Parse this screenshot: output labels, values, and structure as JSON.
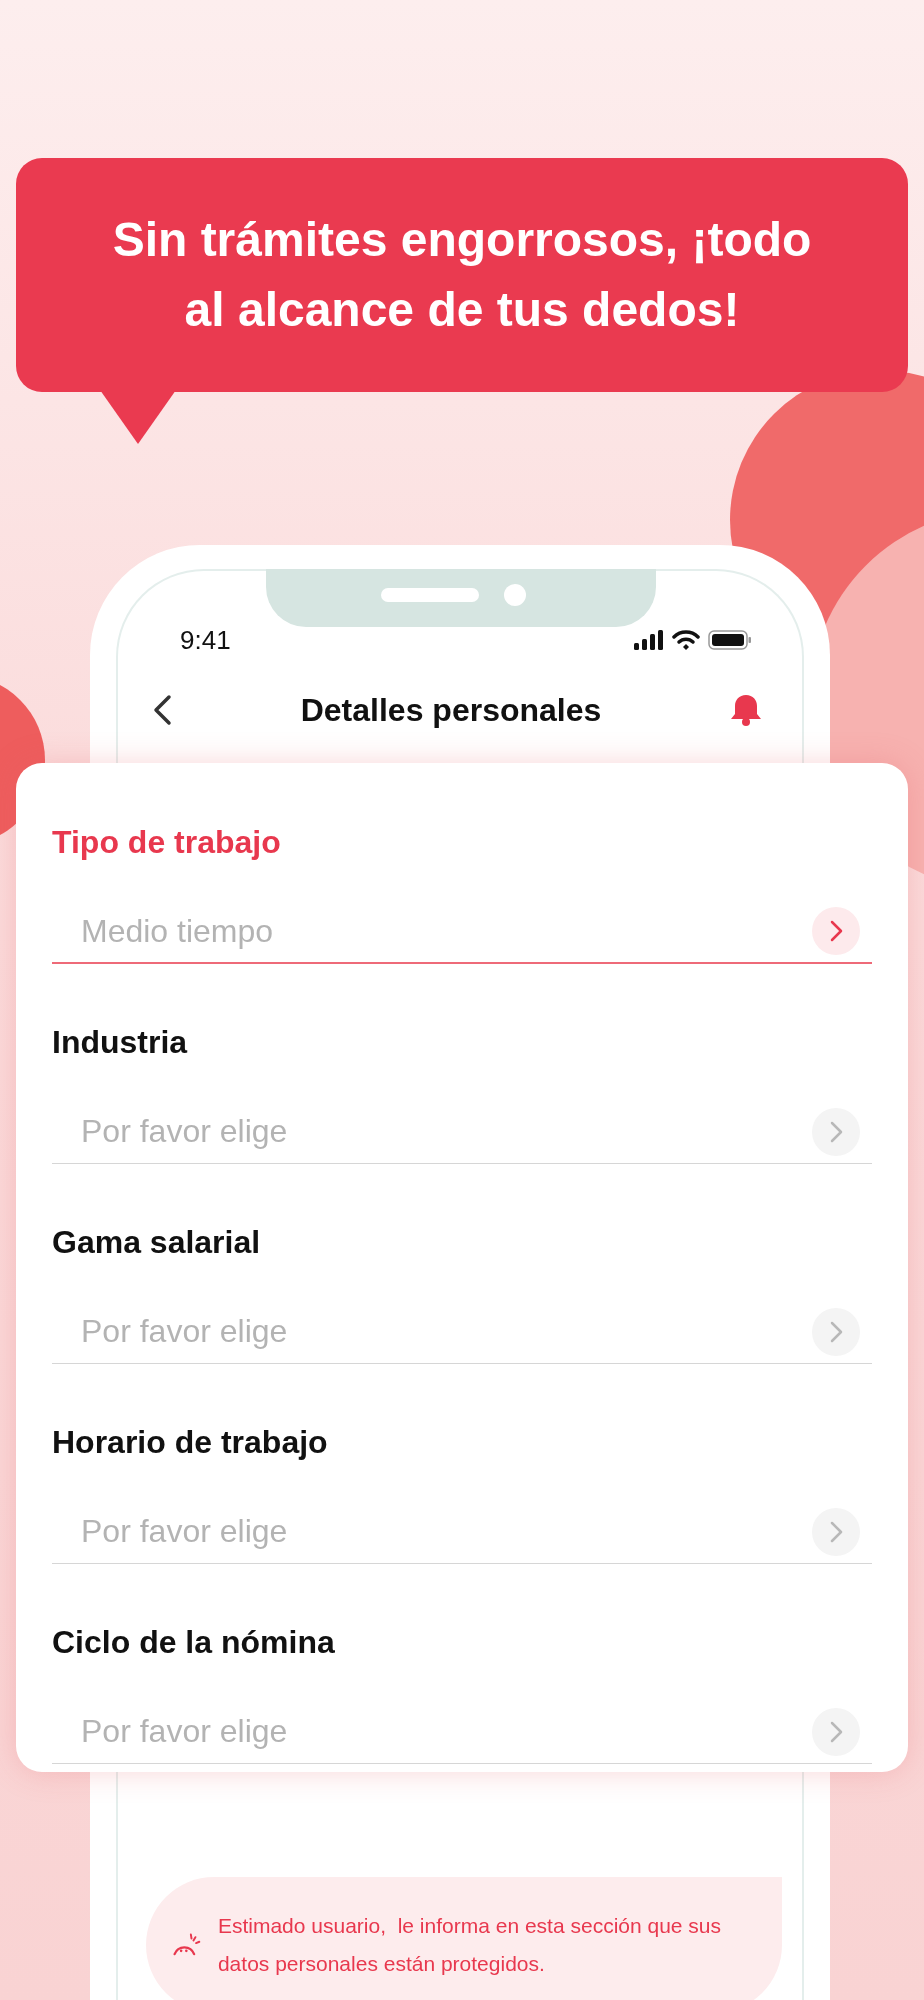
{
  "headline": "Sin trámites engorrosos, ¡todo al alcance de tus dedos!",
  "status_bar": {
    "time": "9:41"
  },
  "header": {
    "title": "Detalles personales"
  },
  "fields": [
    {
      "label": "Tipo de trabajo",
      "value": "Medio tiempo",
      "active": true
    },
    {
      "label": "Industria",
      "placeholder": "Por favor elige",
      "active": false
    },
    {
      "label": "Gama salarial",
      "placeholder": "Por favor elige",
      "active": false
    },
    {
      "label": "Horario de trabajo",
      "placeholder": "Por favor elige",
      "active": false
    },
    {
      "label": "Ciclo de la nómina",
      "placeholder": "Por favor elige",
      "active": false
    }
  ],
  "notice": "Estimado usuario,  le informa en esta sección que sus datos personales están protegidos."
}
